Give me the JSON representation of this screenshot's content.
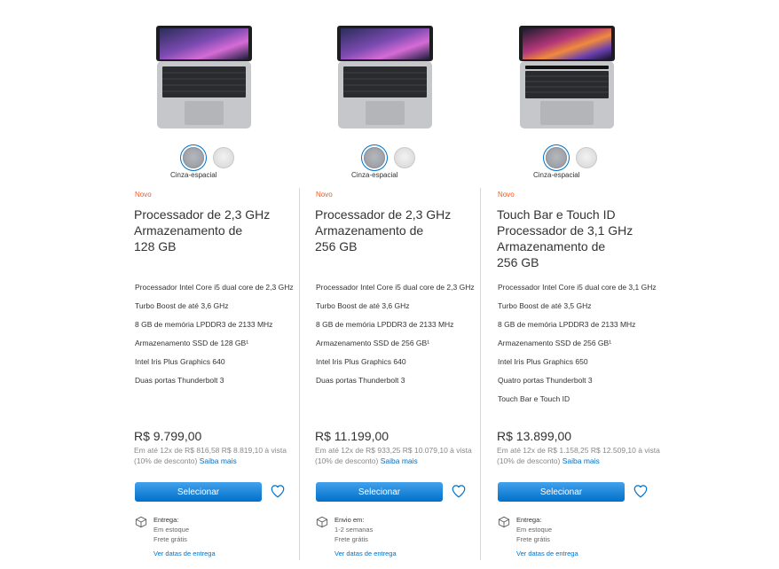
{
  "products": [
    {
      "color_label": "Cinza-espacial",
      "badge": "Novo",
      "title_lines": [
        "Processador de 2,3 GHz",
        "Armazenamento de",
        "128 GB"
      ],
      "specs": [
        "Processador Intel Core i5 dual core de 2,3 GHz",
        "Turbo Boost de até 3,6 GHz",
        "8 GB de memória LPDDR3 de 2133 MHz",
        "Armazenamento SSD de 128 GB¹",
        "Intel Iris Plus Graphics 640",
        "Duas portas Thunderbolt 3"
      ],
      "price": "R$ 9.799,00",
      "installments": "Em até 12x de R$ 816,58 R$ 8.819,10 à vista (10% de desconto)",
      "saiba_mais": "Saiba mais",
      "select_label": "Selecionar",
      "shipping_heading": "Entrega:",
      "shipping_line1": "Em estoque",
      "shipping_line2": "Frete grátis",
      "delivery_link": "Ver datas de entrega"
    },
    {
      "color_label": "Cinza-espacial",
      "badge": "Novo",
      "title_lines": [
        "Processador de 2,3 GHz",
        "Armazenamento de",
        "256 GB"
      ],
      "specs": [
        "Processador Intel Core i5 dual core de 2,3 GHz",
        "Turbo Boost de até 3,6 GHz",
        "8 GB de memória LPDDR3 de 2133 MHz",
        "Armazenamento SSD de 256 GB¹",
        "Intel Iris Plus Graphics 640",
        "Duas portas Thunderbolt 3"
      ],
      "price": "R$ 11.199,00",
      "installments": "Em até 12x de R$ 933,25 R$ 10.079,10 à vista (10% de desconto)",
      "saiba_mais": "Saiba mais",
      "select_label": "Selecionar",
      "shipping_heading": "Envio em:",
      "shipping_line1": "1-2 semanas",
      "shipping_line2": "Frete grátis",
      "delivery_link": "Ver datas de entrega"
    },
    {
      "color_label": "Cinza-espacial",
      "badge": "Novo",
      "title_lines": [
        "Touch Bar e Touch ID",
        "Processador de 3,1 GHz",
        "Armazenamento de",
        "256 GB"
      ],
      "specs": [
        "Processador Intel Core i5 dual core de 3,1 GHz",
        "Turbo Boost de até 3,5 GHz",
        "8 GB de memória LPDDR3 de 2133 MHz",
        "Armazenamento SSD de 256 GB¹",
        "Intel Iris Plus Graphics 650",
        "Quatro portas Thunderbolt 3",
        "Touch Bar e Touch ID"
      ],
      "price": "R$ 13.899,00",
      "installments": "Em até 12x de R$ 1.158,25 R$ 12.509,10 à vista (10% de desconto)",
      "saiba_mais": "Saiba mais",
      "select_label": "Selecionar",
      "shipping_heading": "Entrega:",
      "shipping_line1": "Em estoque",
      "shipping_line2": "Frete grátis",
      "delivery_link": "Ver datas de entrega"
    }
  ],
  "colors": {
    "accent": "#0070c9",
    "new_badge": "#ef5b25",
    "space_gray": "#a1a4a9",
    "silver": "#e3e3e3"
  }
}
